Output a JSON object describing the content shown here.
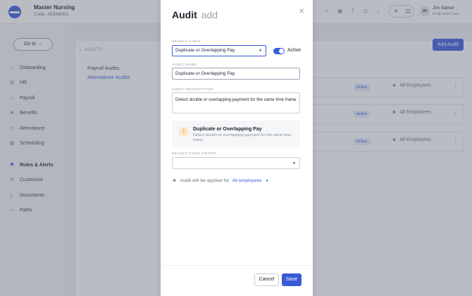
{
  "org": {
    "name": "Master Nursing",
    "code": "Code: #DEMO01"
  },
  "user": {
    "initials": "JK",
    "name": "Jim Satner",
    "email": "jim@master.com"
  },
  "topbar": {
    "icons": [
      "search-icon",
      "calendar-icon",
      "help-icon",
      "clock-icon",
      "bell-icon"
    ],
    "toggle_icons": [
      "sliders-icon",
      "view-icon"
    ]
  },
  "sidebar": {
    "goto_label": "Go to",
    "items": [
      {
        "label": "Onboarding",
        "icon": "onboarding-icon"
      },
      {
        "label": "HR",
        "icon": "hr-icon"
      },
      {
        "label": "Payroll",
        "icon": "payroll-icon"
      },
      {
        "label": "Benefits",
        "icon": "benefits-icon"
      },
      {
        "label": "Attendance",
        "icon": "attendance-icon"
      },
      {
        "label": "Scheduling",
        "icon": "scheduling-icon"
      },
      {
        "label": "Rules & Alerts",
        "icon": "rules-icon",
        "active": true
      },
      {
        "label": "Customize",
        "icon": "customize-icon"
      },
      {
        "label": "Documents",
        "icon": "documents-icon"
      },
      {
        "label": "Paths",
        "icon": "paths-icon"
      }
    ]
  },
  "audits_panel": {
    "crumb": "AUDITS",
    "links": [
      "Payroll Audits",
      "Attendance Audits"
    ],
    "add_button": "Add Audit",
    "rows": [
      {
        "status": "Active",
        "applies_to": "All Employees"
      },
      {
        "status": "Active",
        "applies_to": "All Employees"
      },
      {
        "status": "Active",
        "applies_to": "All Employees"
      }
    ]
  },
  "modal": {
    "title": "Audit",
    "title_suffix": "add",
    "select_audit_label": "SELECT AUDIT",
    "select_audit_value": "Duplicate or Overlapping Pay",
    "active_label": "Active",
    "active": true,
    "audit_name_label": "AUDIT NAME",
    "audit_name_value": "Duplicate or Overlapping Pay",
    "audit_description_label": "AUDIT DESCRIPTION",
    "audit_description_value": "Detect double or overlapping payment for the same time frame",
    "info_title": "Duplicate or Overlapping Pay",
    "info_desc": "Detect double or overlapping payment for the same time frame",
    "code_group_label": "SELECT CODE GROUP",
    "code_group_value": "",
    "applied_prefix": "Audit will be applied for",
    "applied_target": "All employees",
    "cancel_label": "Cancel",
    "save_label": "Save"
  },
  "colors": {
    "accent": "#3a5bd9",
    "warning": "#e8962e"
  }
}
